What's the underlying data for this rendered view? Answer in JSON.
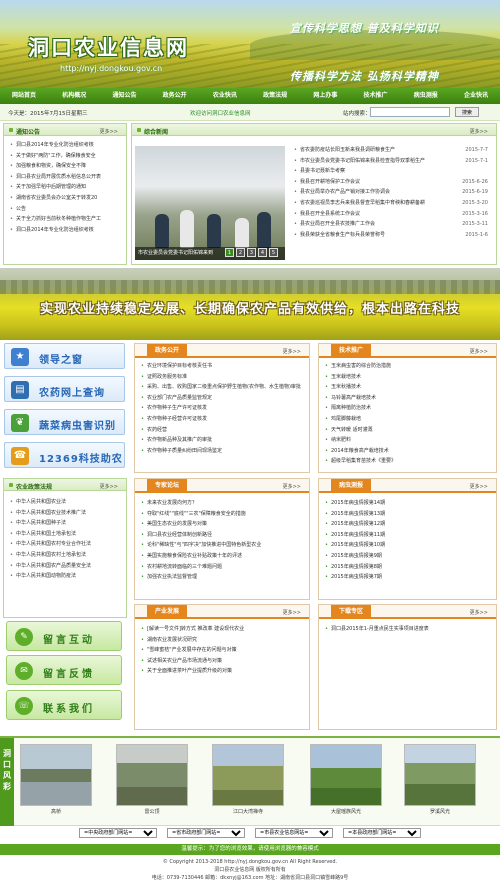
{
  "header": {
    "title": "洞口农业信息网",
    "url": "http://nyj.dongkou.gov.cn",
    "slogan_top": "宣传科学思想  普及科学知识",
    "slogan_bottom": "传播科学方法  弘扬科学精神"
  },
  "nav": [
    "网站首页",
    "机构概况",
    "通知公告",
    "政务公开",
    "农业快讯",
    "政策法规",
    "网上办事",
    "技术推广",
    "病虫测报",
    "企业快讯"
  ],
  "infobar": {
    "date": "今天是：2015年7月15日星期三",
    "welcome": "欢迎访问洞口农业信息网",
    "search_label": "站内搜索：",
    "search_value": "",
    "search_button": "搜索"
  },
  "notice": {
    "title": "通知公告",
    "more": "更多>>",
    "items": [
      "洞口县2014年专业化防治组织考核",
      "关于做好\"两防\"工作，确保粮食安全",
      "加强粮食和物资，确保安全不降",
      "洞口县农业局开展优质水稻信息公开表",
      "关于加强早稻中后期管理的通知",
      "湖南省农业委员会办公室关于转发20",
      "公告",
      "关于全力抓好当前秋冬种植作物生产工",
      "洞口县2014年专业化防治组织考核"
    ]
  },
  "news": {
    "title": "综合新闻",
    "more": "更多>>",
    "caption": "市农业委员会党委书记阳佑锦来到",
    "pages": [
      "1",
      "2",
      "3",
      "4",
      "5"
    ],
    "items": [
      {
        "t": "省农委防疫站长阳玉新来我县调研粮食生产",
        "d": "2015-7-7"
      },
      {
        "t": "市农业委员会党委书记阳佑锦来我县检查指导双季稻生产",
        "d": "2015-7-1"
      },
      {
        "t": "县委书记聂新华考察",
        "d": ""
      },
      {
        "t": "我县召开耕地保护工作会议",
        "d": "2015-6-26"
      },
      {
        "t": "县农业局举办农产品产销对接工作协调会",
        "d": "2015-6-19"
      },
      {
        "t": "省农委巡视员李志兵来我县督查早稻集中育秧和春耕备耕",
        "d": "2015-3-20"
      },
      {
        "t": "我县召开全县系统工作会议",
        "d": "2015-3-16"
      },
      {
        "t": "县农业局召开全县农技推广工作会",
        "d": "2015-3-11"
      },
      {
        "t": "我县荣获全省粮食生产标兵县荣誉称号",
        "d": "2015-1-6"
      }
    ]
  },
  "banner": {
    "text": "实现农业持续稳定发展、长期确保农产品有效供给，根本出路在科技"
  },
  "quicklinks": [
    {
      "label": "领导之窗",
      "icon": "leader-icon"
    },
    {
      "label": "农药网上查询",
      "icon": "book-icon"
    },
    {
      "label": "蔬菜病虫害识别",
      "icon": "leaf-icon"
    },
    {
      "label": "12369科技助农",
      "icon": "phone-icon"
    }
  ],
  "laws": {
    "title": "农业政策法规",
    "more": "更多>>",
    "items": [
      "中华人民共和国农业法",
      "中华人民共和国农业技术推广法",
      "中华人民共和国种子法",
      "中华人民共和国土地承包法",
      "中华人民共和国农村专业合作社法",
      "中华人民共和国农村土地承包法",
      "中华人民共和国农产品质量安全法",
      "中华人民共和国动物防疫法"
    ]
  },
  "greenbuttons": [
    {
      "label": "留言互动",
      "icon": "chat-icon"
    },
    {
      "label": "留言反馈",
      "icon": "feedback-icon"
    },
    {
      "label": "联系我们",
      "icon": "contact-icon"
    }
  ],
  "gov": {
    "title": "政务公开",
    "more": "更多>>",
    "items": [
      "农业环境保护目标考核责任书",
      "证照政务服务标准",
      "采购、出售、收购国家二级重点保护野生植物(农作物、水生植物)审批",
      "农业部门农产品质量监管规定",
      "农作物种子生产许可证核发",
      "农作物种子经营许可证核发",
      "农药经营",
      "农作物新品种及其推广的审批",
      "农作物种子质量纠纷田间现场鉴定"
    ]
  },
  "tech": {
    "title": "技术推广",
    "more": "更多>>",
    "items": [
      "玉米病虫害的综合防治措施",
      "玉米栽培技术",
      "玉米秋播技术",
      "马铃薯高产栽培技术",
      "隔离种植防治技术",
      "鸡尾脚藤栽培",
      "天气转暖  适时灌溉",
      "纳米肥料",
      "2014年粮食高产栽培技术",
      "超级早稻集育苗技术《重要》"
    ]
  },
  "expert": {
    "title": "专家论坛",
    "more": "更多>>",
    "items": [
      "未来农业发展向何方？",
      "夺取\"红线\"\"底线\"\"三农\"保障粮食安全的措施",
      "美国生态农业的发展与对策",
      "洞口县农业经营体制创新路径",
      "论科\"稀缺性\"与\"四字决\"加快推进中国特色新型农业",
      "美国实施粮食保险农业补贴政策十年的评述",
      "农村耕地流转面临的三个难题问题",
      "加强农业执法监督管理"
    ]
  },
  "pest": {
    "title": "病虫测报",
    "more": "更多>>",
    "items": [
      "2015年病虫情报第14期",
      "2015年病虫情报第13期",
      "2015年病虫情报第12期",
      "2015年病虫情报第11期",
      "2015年病虫情报第10期",
      "2015年病虫情报第9期",
      "2015年病虫情报第8期",
      "2015年病虫情报第7期"
    ]
  },
  "industry": {
    "title": "产业发展",
    "more": "更多>>",
    "items": [
      "[解读一号文件]转方式 推改革 建设现代农业",
      "湖南农业发展状况研究",
      "\"雪峰蜜桔\"产业发展中存在的问题与对策",
      "试述相关农业产品市场流通与对策",
      "关于全面推进茶叶产业提质升级的对策"
    ]
  },
  "download": {
    "title": "下载专区",
    "more": "更多>>",
    "items": [
      "洞口县2015年1-月重点民生实事项目进度表"
    ]
  },
  "scenery": {
    "label": "洞口风彩",
    "pics": [
      "高桥",
      "雷公顶",
      "江口大湾禅寺",
      "大屋瑶族风光",
      "罗溪风光"
    ]
  },
  "links": [
    "=中央政府部门网站=",
    "=省市政府部门网站=",
    "=市县农业信息网站=",
    "=本县政府部门网站="
  ],
  "notice_bar": "温馨提示：为了您的浏览效果，请使用浏览器的兼容模式",
  "footer": [
    "© Copyright 2013-2018 http://nyj.dongkou.gov.cn All Right Reserved.",
    "洞口县农业信息网 版权所有所有",
    "电话：0739-7130446 邮箱：dkxnyj@163.com 地址：湖南省洞口县洞口镇雪峰路9号"
  ],
  "colors": {
    "primary_green": "#5aa621",
    "accent_orange": "#e4861e",
    "blue": "#2666b6"
  }
}
